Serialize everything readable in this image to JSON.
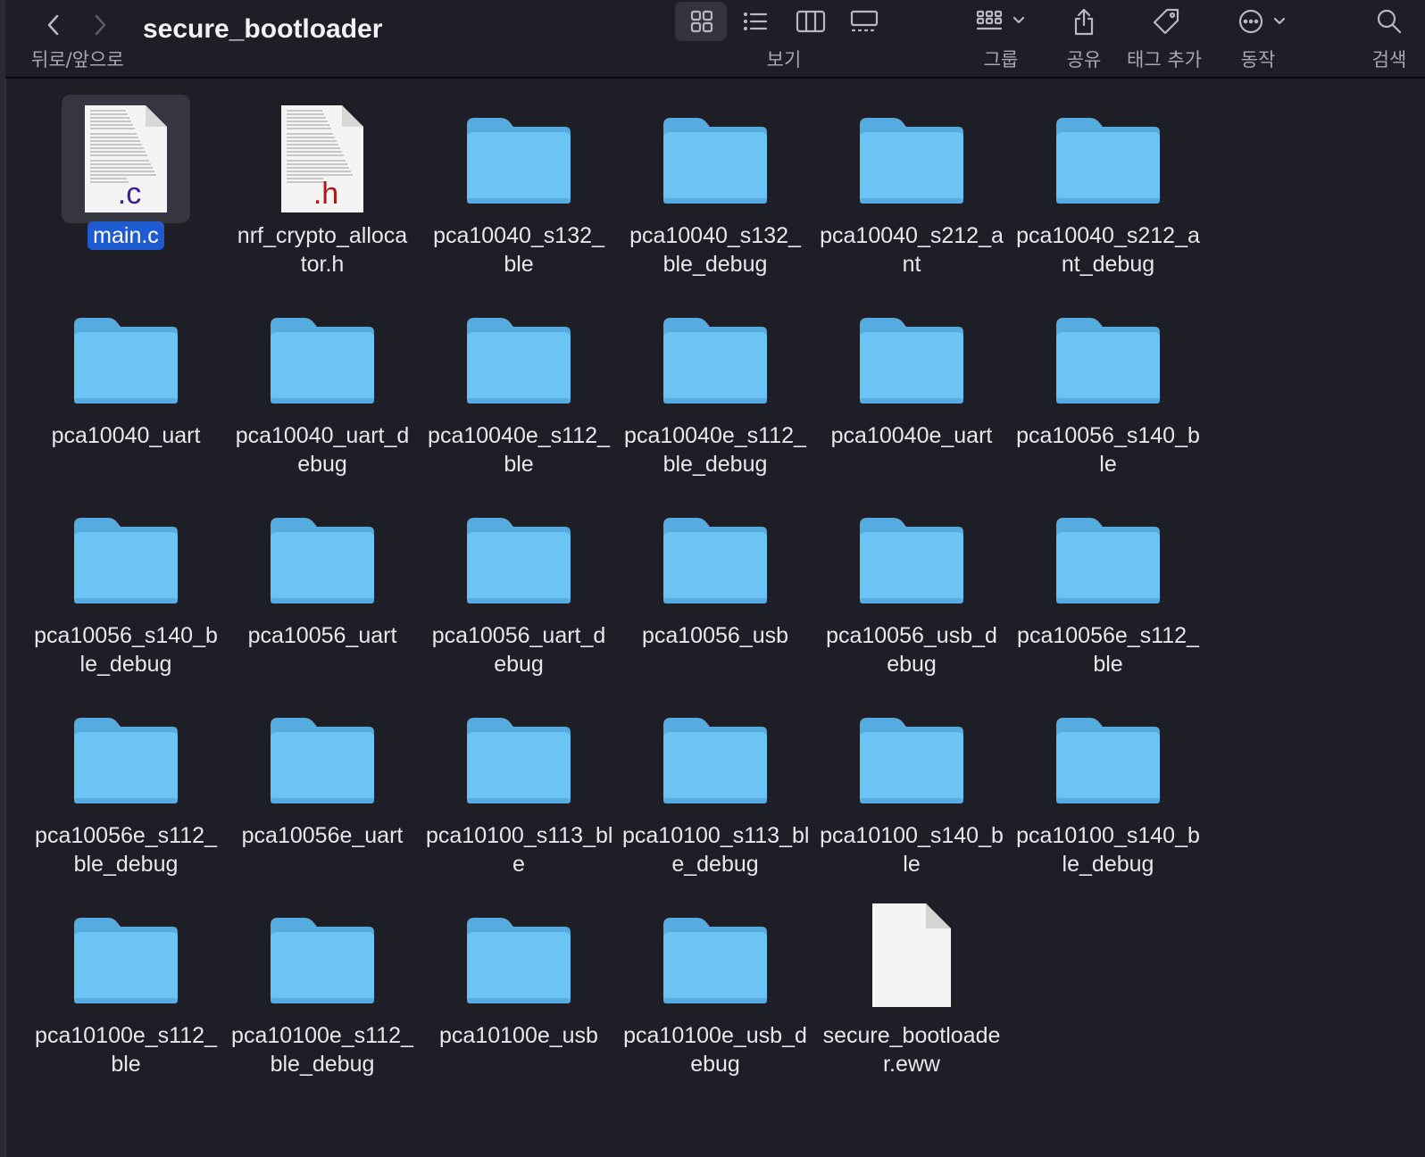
{
  "window": {
    "title": "secure_bootloader",
    "nav_label": "뒤로/앞으로"
  },
  "toolbar": {
    "view_label": "보기",
    "group_label": "그룹",
    "share_label": "공유",
    "tag_label": "태그 추가",
    "action_label": "동작",
    "search_label": "검색"
  },
  "files": [
    {
      "name": "main.c",
      "kind": "c-file",
      "selected": true
    },
    {
      "name": "nrf_crypto_alloca\ntor.h",
      "kind": "h-file"
    },
    {
      "name": "pca10040_s132_\nble",
      "kind": "folder"
    },
    {
      "name": "pca10040_s132_\nble_debug",
      "kind": "folder"
    },
    {
      "name": "pca10040_s212_a\nnt",
      "kind": "folder"
    },
    {
      "name": "pca10040_s212_a\nnt_debug",
      "kind": "folder"
    },
    {
      "name": "pca10040_uart",
      "kind": "folder"
    },
    {
      "name": "pca10040_uart_d\nebug",
      "kind": "folder"
    },
    {
      "name": "pca10040e_s112_\nble",
      "kind": "folder"
    },
    {
      "name": "pca10040e_s112_\nble_debug",
      "kind": "folder"
    },
    {
      "name": "pca10040e_uart",
      "kind": "folder"
    },
    {
      "name": "pca10056_s140_b\nle",
      "kind": "folder"
    },
    {
      "name": "pca10056_s140_b\nle_debug",
      "kind": "folder"
    },
    {
      "name": "pca10056_uart",
      "kind": "folder"
    },
    {
      "name": "pca10056_uart_d\nebug",
      "kind": "folder"
    },
    {
      "name": "pca10056_usb",
      "kind": "folder"
    },
    {
      "name": "pca10056_usb_d\nebug",
      "kind": "folder"
    },
    {
      "name": "pca10056e_s112_\nble",
      "kind": "folder"
    },
    {
      "name": "pca10056e_s112_\nble_debug",
      "kind": "folder"
    },
    {
      "name": "pca10056e_uart",
      "kind": "folder"
    },
    {
      "name": "pca10100_s113_bl\ne",
      "kind": "folder"
    },
    {
      "name": "pca10100_s113_bl\ne_debug",
      "kind": "folder"
    },
    {
      "name": "pca10100_s140_b\nle",
      "kind": "folder"
    },
    {
      "name": "pca10100_s140_b\nle_debug",
      "kind": "folder"
    },
    {
      "name": "pca10100e_s112_\nble",
      "kind": "folder"
    },
    {
      "name": "pca10100e_s112_\nble_debug",
      "kind": "folder"
    },
    {
      "name": "pca10100e_usb",
      "kind": "folder"
    },
    {
      "name": "pca10100e_usb_d\nebug",
      "kind": "folder"
    },
    {
      "name": "secure_bootloade\nr.eww",
      "kind": "blank-file"
    }
  ],
  "colors": {
    "folder": "#6cc4f4",
    "folder_top": "#56ace0",
    "selection": "#1e5bd0",
    "c_badge": "#3b1f8a",
    "h_badge": "#b01818"
  }
}
